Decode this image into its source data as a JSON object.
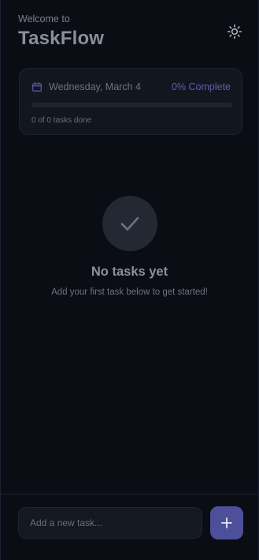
{
  "header": {
    "welcome_text": "Welcome to",
    "app_title": "TaskFlow",
    "theme_toggle_icon": "sun-icon"
  },
  "summary": {
    "date": "Wednesday, March 4",
    "complete_label": "0% Complete",
    "progress_fraction": 0,
    "tasks_done": "0 of 0 tasks done",
    "calendar_icon": "calendar-icon"
  },
  "empty_state": {
    "icon": "checkmark-icon",
    "title": "No tasks yet",
    "subtitle": "Add your first task below to get started!"
  },
  "composer": {
    "input_value": "",
    "input_placeholder": "Add a new task...",
    "add_icon": "plus-icon"
  },
  "colors": {
    "accent": "#6366f1",
    "accent_button": "#4e4f9a",
    "background": "#0a0d14",
    "card": "#12161f"
  }
}
